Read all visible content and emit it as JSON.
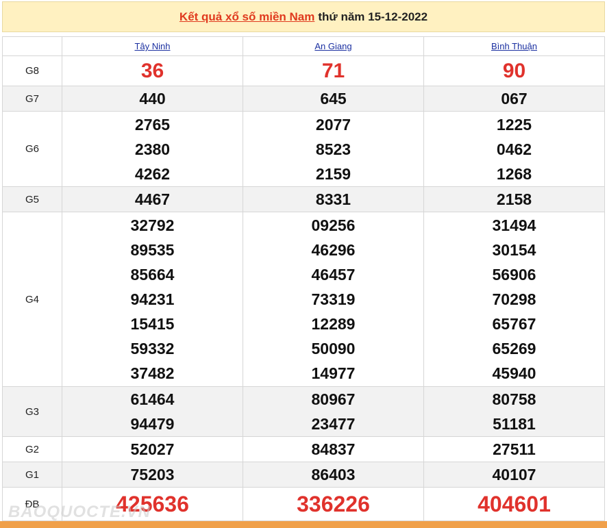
{
  "header": {
    "link_text": "Kết quả xổ số miền Nam",
    "date_text": "thứ năm 15-12-2022"
  },
  "provinces": [
    "Tây Ninh",
    "An Giang",
    "Bình Thuận"
  ],
  "prizes": [
    {
      "label": "G8",
      "values": [
        [
          "36"
        ],
        [
          "71"
        ],
        [
          "90"
        ]
      ]
    },
    {
      "label": "G7",
      "values": [
        [
          "440"
        ],
        [
          "645"
        ],
        [
          "067"
        ]
      ]
    },
    {
      "label": "G6",
      "values": [
        [
          "2765",
          "2380",
          "4262"
        ],
        [
          "2077",
          "8523",
          "2159"
        ],
        [
          "1225",
          "0462",
          "1268"
        ]
      ]
    },
    {
      "label": "G5",
      "values": [
        [
          "4467"
        ],
        [
          "8331"
        ],
        [
          "2158"
        ]
      ]
    },
    {
      "label": "G4",
      "values": [
        [
          "32792",
          "89535",
          "85664",
          "94231",
          "15415",
          "59332",
          "37482"
        ],
        [
          "09256",
          "46296",
          "46457",
          "73319",
          "12289",
          "50090",
          "14977"
        ],
        [
          "31494",
          "30154",
          "56906",
          "70298",
          "65767",
          "65269",
          "45940"
        ]
      ]
    },
    {
      "label": "G3",
      "values": [
        [
          "61464",
          "94479"
        ],
        [
          "80967",
          "23477"
        ],
        [
          "80758",
          "51181"
        ]
      ]
    },
    {
      "label": "G2",
      "values": [
        [
          "52027"
        ],
        [
          "84837"
        ],
        [
          "27511"
        ]
      ]
    },
    {
      "label": "G1",
      "values": [
        [
          "75203"
        ],
        [
          "86403"
        ],
        [
          "40107"
        ]
      ]
    },
    {
      "label": "ĐB",
      "values": [
        [
          "425636"
        ],
        [
          "336226"
        ],
        [
          "404601"
        ]
      ]
    }
  ],
  "watermark": "BAOQUOCTE.VN",
  "colors": {
    "accent": "#e03a1e",
    "header_bg": "#fff1c1",
    "footer_bar": "#f0a04a"
  }
}
